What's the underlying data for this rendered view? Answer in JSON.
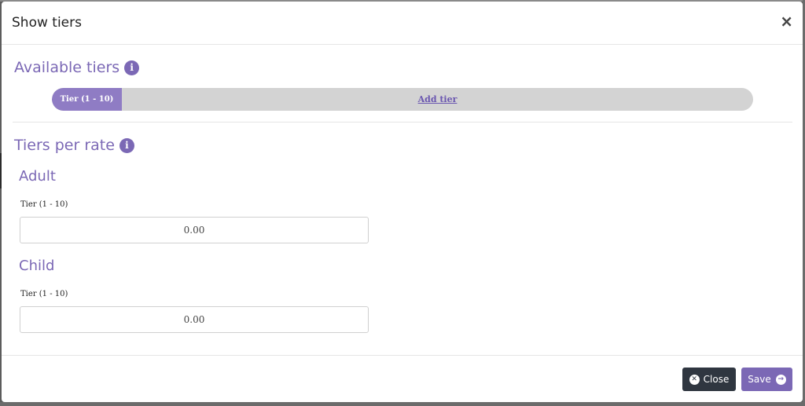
{
  "modal": {
    "title": "Show tiers",
    "close_glyph": "×"
  },
  "available_tiers": {
    "title": "Available tiers",
    "info_icon": "i",
    "tier_label": "Tier (1 - 10)",
    "add_tier_label": "Add tier"
  },
  "tiers_per_rate": {
    "title": "Tiers per rate",
    "info_icon": "i",
    "rates": [
      {
        "name": "Adult",
        "field_label": "Tier (1 - 10)",
        "value": "0.00"
      },
      {
        "name": "Child",
        "field_label": "Tier (1 - 10)",
        "value": "0.00"
      }
    ]
  },
  "footer": {
    "close_label": "Close",
    "close_icon": "x-circle-icon",
    "save_label": "Save",
    "save_icon": "arrow-right-circle-icon"
  },
  "colors": {
    "accent": "#7b68b5",
    "accent_light": "#8f7cc4",
    "dark_button": "#2f3640",
    "track": "#d3d3d3"
  }
}
